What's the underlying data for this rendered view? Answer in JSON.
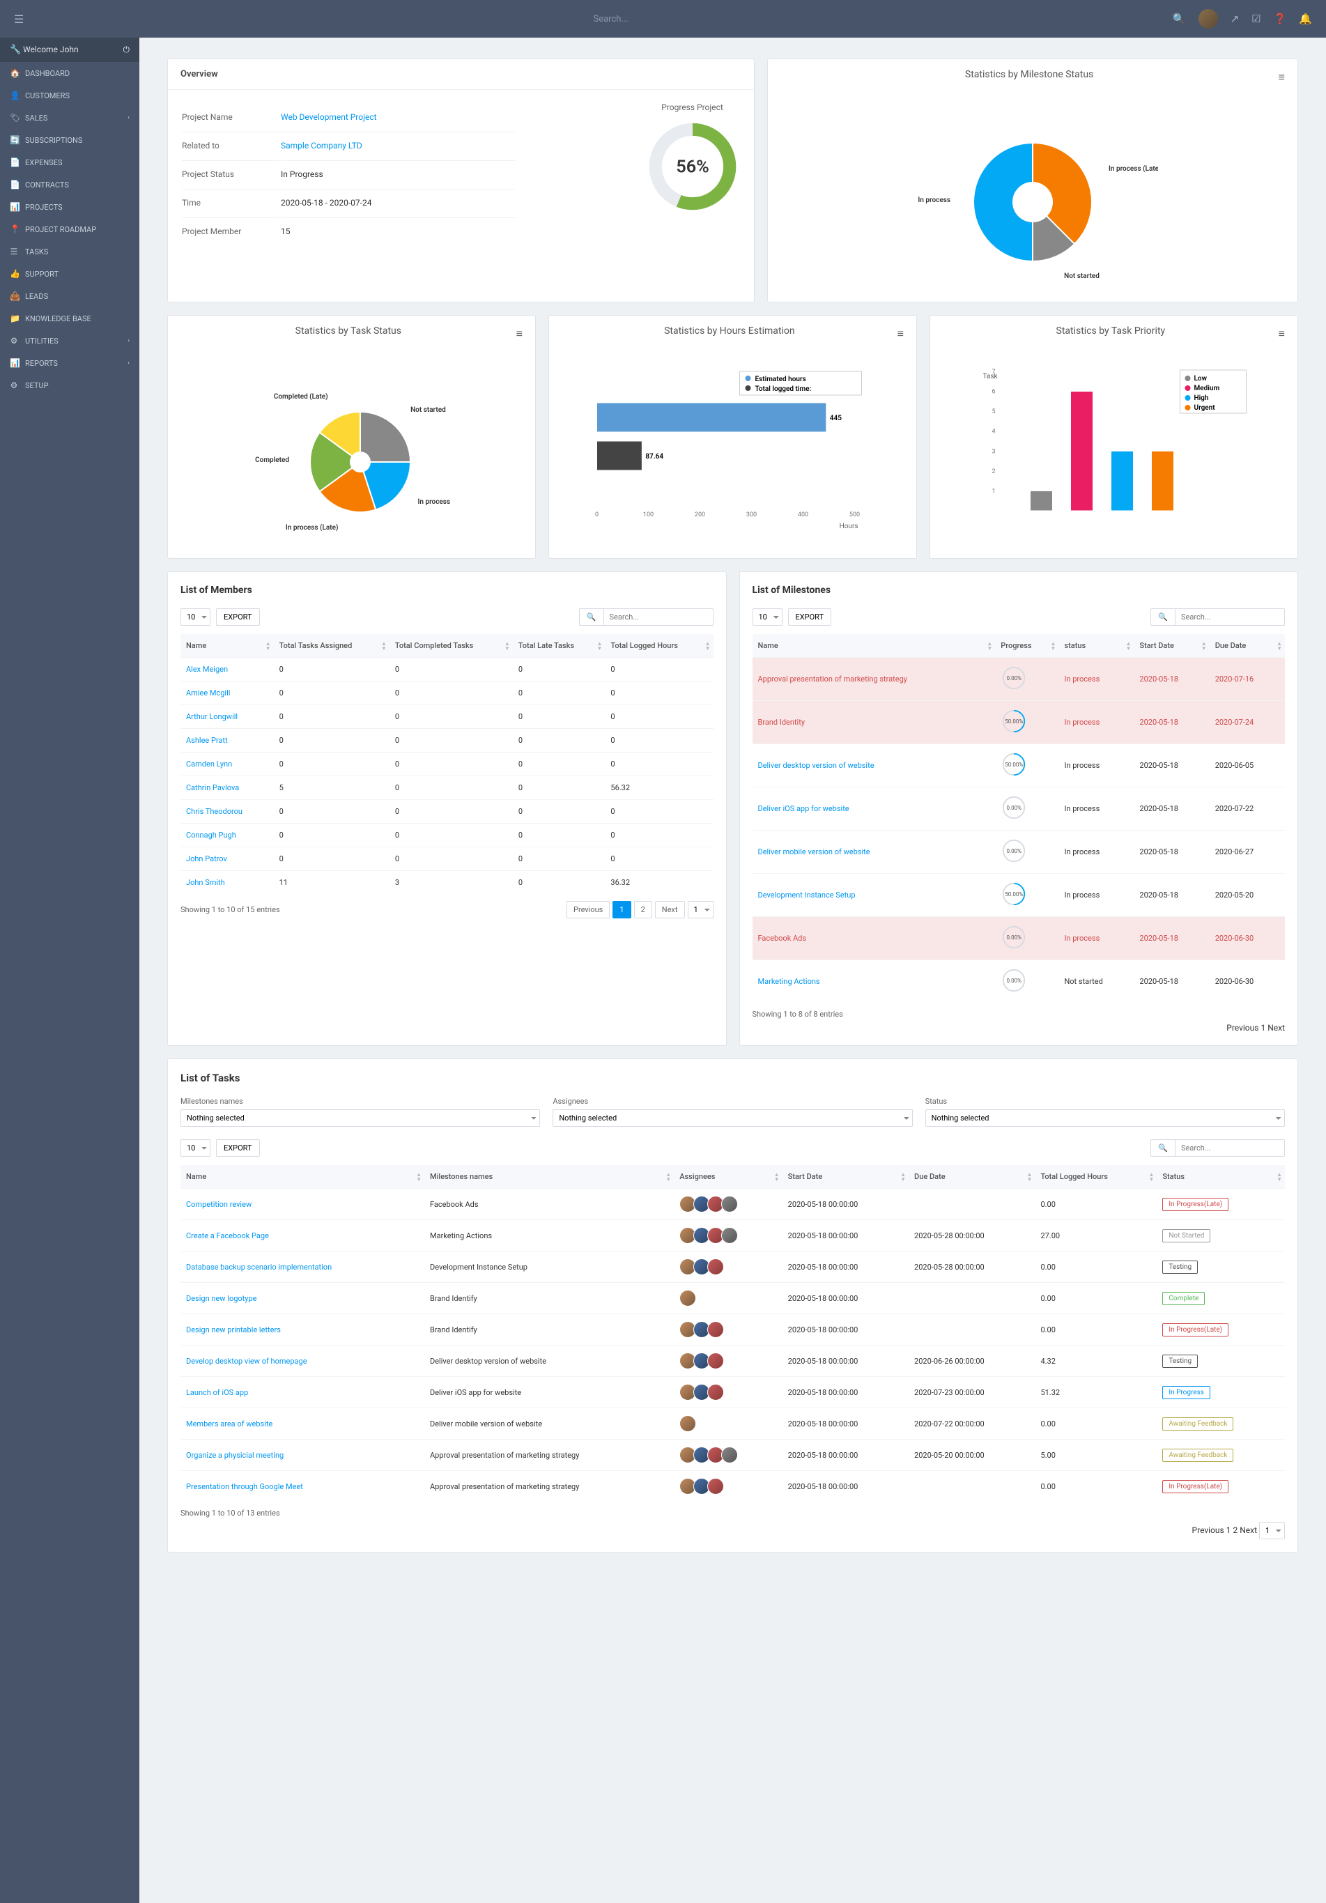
{
  "topbar": {
    "search_placeholder": "Search...",
    "welcome": "Welcome John"
  },
  "menu": [
    {
      "icon": "🏠",
      "label": "DASHBOARD"
    },
    {
      "icon": "👤",
      "label": "CUSTOMERS"
    },
    {
      "icon": "🏷",
      "label": "SALES",
      "chev": true
    },
    {
      "icon": "🔄",
      "label": "SUBSCRIPTIONS"
    },
    {
      "icon": "📄",
      "label": "EXPENSES"
    },
    {
      "icon": "📄",
      "label": "CONTRACTS"
    },
    {
      "icon": "📊",
      "label": "PROJECTS"
    },
    {
      "icon": "📍",
      "label": "PROJECT ROADMAP"
    },
    {
      "icon": "☰",
      "label": "TASKS"
    },
    {
      "icon": "👍",
      "label": "SUPPORT"
    },
    {
      "icon": "👜",
      "label": "LEADS"
    },
    {
      "icon": "📁",
      "label": "KNOWLEDGE BASE"
    },
    {
      "icon": "⚙",
      "label": "UTILITIES",
      "chev": true
    },
    {
      "icon": "📊",
      "label": "REPORTS",
      "chev": true
    },
    {
      "icon": "⚙",
      "label": "SETUP"
    }
  ],
  "overview": {
    "title": "Overview",
    "rows": [
      {
        "k": "Project Name",
        "v": "Web Development Project",
        "link": true
      },
      {
        "k": "Related to",
        "v": "Sample Company LTD",
        "link": true
      },
      {
        "k": "Project Status",
        "v": "In Progress"
      },
      {
        "k": "Time",
        "v": "2020-05-18 - 2020-07-24"
      },
      {
        "k": "Project Member",
        "v": "15"
      }
    ],
    "progress_label": "Progress Project",
    "progress_value": "56%",
    "progress_pct": 56
  },
  "chart_data": [
    {
      "type": "pie",
      "title": "Statistics by Milestone Status",
      "series": [
        {
          "name": "In process (Late)",
          "value": 37.5,
          "color": "#f57c00"
        },
        {
          "name": "Not started",
          "value": 12.5,
          "color": "#888888"
        },
        {
          "name": "In process",
          "value": 50,
          "color": "#03a9f4"
        }
      ]
    },
    {
      "type": "pie",
      "title": "Statistics by Task Status",
      "series": [
        {
          "name": "Not started",
          "value": 25,
          "color": "#888888"
        },
        {
          "name": "In process",
          "value": 20,
          "color": "#03a9f4"
        },
        {
          "name": "In process (Late)",
          "value": 20,
          "color": "#f57c00"
        },
        {
          "name": "Completed",
          "value": 20,
          "color": "#7cb342"
        },
        {
          "name": "Completed (Late)",
          "value": 15,
          "color": "#fdd835"
        }
      ]
    },
    {
      "type": "bar",
      "title": "Statistics by Hours Estimation",
      "xlabel": "Hours",
      "xlim": [
        0,
        500
      ],
      "series": [
        {
          "name": "Estimated hours",
          "value": 445,
          "color": "#5b9bd5"
        },
        {
          "name": "Total logged time:",
          "value": 87.64,
          "color": "#444444"
        }
      ]
    },
    {
      "type": "bar",
      "title": "Statistics by Task Priority",
      "ylabel": "Task",
      "ylim": [
        0,
        7
      ],
      "categories": [
        "Low",
        "Medium",
        "High",
        "Urgent"
      ],
      "values": [
        1,
        6,
        3,
        3
      ],
      "colors": [
        "#888888",
        "#e91e63",
        "#03a9f4",
        "#f57c00"
      ]
    }
  ],
  "members": {
    "title": "List of Members",
    "page_size": "10",
    "export": "EXPORT",
    "search_placeholder": "Search...",
    "cols": [
      "Name",
      "Total Tasks Assigned",
      "Total Completed Tasks",
      "Total Late Tasks",
      "Total Logged Hours"
    ],
    "rows": [
      [
        "Alex Meigen",
        "0",
        "0",
        "0",
        "0"
      ],
      [
        "Amiee Mcgill",
        "0",
        "0",
        "0",
        "0"
      ],
      [
        "Arthur Longwill",
        "0",
        "0",
        "0",
        "0"
      ],
      [
        "Ashlee Pratt",
        "0",
        "0",
        "0",
        "0"
      ],
      [
        "Camden Lynn",
        "0",
        "0",
        "0",
        "0"
      ],
      [
        "Cathrin Pavlova",
        "5",
        "0",
        "0",
        "56.32"
      ],
      [
        "Chris Theodorou",
        "0",
        "0",
        "0",
        "0"
      ],
      [
        "Connagh Pugh",
        "0",
        "0",
        "0",
        "0"
      ],
      [
        "John Patrov",
        "0",
        "0",
        "0",
        "0"
      ],
      [
        "John Smith",
        "11",
        "3",
        "0",
        "36.32"
      ]
    ],
    "info": "Showing 1 to 10 of 15 entries",
    "prev": "Previous",
    "next": "Next"
  },
  "milestones": {
    "title": "List of Milestones",
    "page_size": "10",
    "export": "EXPORT",
    "search_placeholder": "Search...",
    "cols": [
      "Name",
      "Progress",
      "status",
      "Start Date",
      "Due Date"
    ],
    "rows": [
      {
        "name": "Approval presentation of marketing strategy",
        "pct": 0,
        "status": "In process",
        "start": "2020-05-18",
        "due": "2020-07-16",
        "late": true
      },
      {
        "name": "Brand Identity",
        "pct": 50,
        "status": "In process",
        "start": "2020-05-18",
        "due": "2020-07-24",
        "late": true
      },
      {
        "name": "Deliver desktop version of website",
        "pct": 50,
        "status": "In process",
        "start": "2020-05-18",
        "due": "2020-06-05"
      },
      {
        "name": "Deliver iOS app for website",
        "pct": 0,
        "status": "In process",
        "start": "2020-05-18",
        "due": "2020-07-22"
      },
      {
        "name": "Deliver mobile version of website",
        "pct": 0,
        "status": "In process",
        "start": "2020-05-18",
        "due": "2020-06-27"
      },
      {
        "name": "Development Instance Setup",
        "pct": 50,
        "status": "In process",
        "start": "2020-05-18",
        "due": "2020-05-20"
      },
      {
        "name": "Facebook Ads",
        "pct": 0,
        "status": "In process",
        "start": "2020-05-18",
        "due": "2020-06-30",
        "late": true
      },
      {
        "name": "Marketing Actions",
        "pct": 0,
        "status": "Not started",
        "start": "2020-05-18",
        "due": "2020-06-30"
      }
    ],
    "info": "Showing 1 to 8 of 8 entries",
    "prev": "Previous",
    "next": "Next"
  },
  "tasks": {
    "title": "List of Tasks",
    "filters": [
      {
        "label": "Milestones names",
        "value": "Nothing selected"
      },
      {
        "label": "Assignees",
        "value": "Nothing selected"
      },
      {
        "label": "Status",
        "value": "Nothing selected"
      }
    ],
    "page_size": "10",
    "export": "EXPORT",
    "search_placeholder": "Search...",
    "cols": [
      "Name",
      "Milestones names",
      "Assignees",
      "Start Date",
      "Due Date",
      "Total Logged Hours",
      "Status"
    ],
    "rows": [
      {
        "name": "Competition review",
        "ms": "Facebook Ads",
        "av": 4,
        "start": "2020-05-18 00:00:00",
        "due": "",
        "hours": "0.00",
        "status": "In Progress(Late)",
        "badge": "b-late"
      },
      {
        "name": "Create a Facebook Page",
        "ms": "Marketing Actions",
        "av": 4,
        "start": "2020-05-18 00:00:00",
        "due": "2020-05-28 00:00:00",
        "hours": "27.00",
        "status": "Not Started",
        "badge": "b-ns"
      },
      {
        "name": "Database backup scenario implementation",
        "ms": "Development Instance Setup",
        "av": 3,
        "start": "2020-05-18 00:00:00",
        "due": "2020-05-28 00:00:00",
        "hours": "0.00",
        "status": "Testing",
        "badge": "b-test"
      },
      {
        "name": "Design new logotype",
        "ms": "Brand Identify",
        "av": 1,
        "start": "2020-05-18 00:00:00",
        "due": "",
        "hours": "0.00",
        "status": "Complete",
        "badge": "b-comp"
      },
      {
        "name": "Design new printable letters",
        "ms": "Brand Identify",
        "av": 3,
        "start": "2020-05-18 00:00:00",
        "due": "",
        "hours": "0.00",
        "status": "In Progress(Late)",
        "badge": "b-late"
      },
      {
        "name": "Develop desktop view of homepage",
        "ms": "Deliver desktop version of website",
        "av": 3,
        "start": "2020-05-18 00:00:00",
        "due": "2020-06-26 00:00:00",
        "hours": "4.32",
        "status": "Testing",
        "badge": "b-test"
      },
      {
        "name": "Launch of iOS app",
        "ms": "Deliver iOS app for website",
        "av": 3,
        "start": "2020-05-18 00:00:00",
        "due": "2020-07-23 00:00:00",
        "hours": "51.32",
        "status": "In Progress",
        "badge": "b-prog"
      },
      {
        "name": "Members area of website",
        "ms": "Deliver mobile version of website",
        "av": 1,
        "start": "2020-05-18 00:00:00",
        "due": "2020-07-22 00:00:00",
        "hours": "0.00",
        "status": "Awaiting Feedback",
        "badge": "b-fb"
      },
      {
        "name": "Organize a physicial meeting",
        "ms": "Approval presentation of marketing strategy",
        "av": 4,
        "start": "2020-05-18 00:00:00",
        "due": "2020-05-20 00:00:00",
        "hours": "5.00",
        "status": "Awaiting Feedback",
        "badge": "b-fb"
      },
      {
        "name": "Presentation through Google Meet",
        "ms": "Approval presentation of marketing strategy",
        "av": 3,
        "start": "2020-05-18 00:00:00",
        "due": "",
        "hours": "0.00",
        "status": "In Progress(Late)",
        "badge": "b-late"
      }
    ],
    "info": "Showing 1 to 10 of 13 entries",
    "prev": "Previous",
    "next": "Next"
  }
}
